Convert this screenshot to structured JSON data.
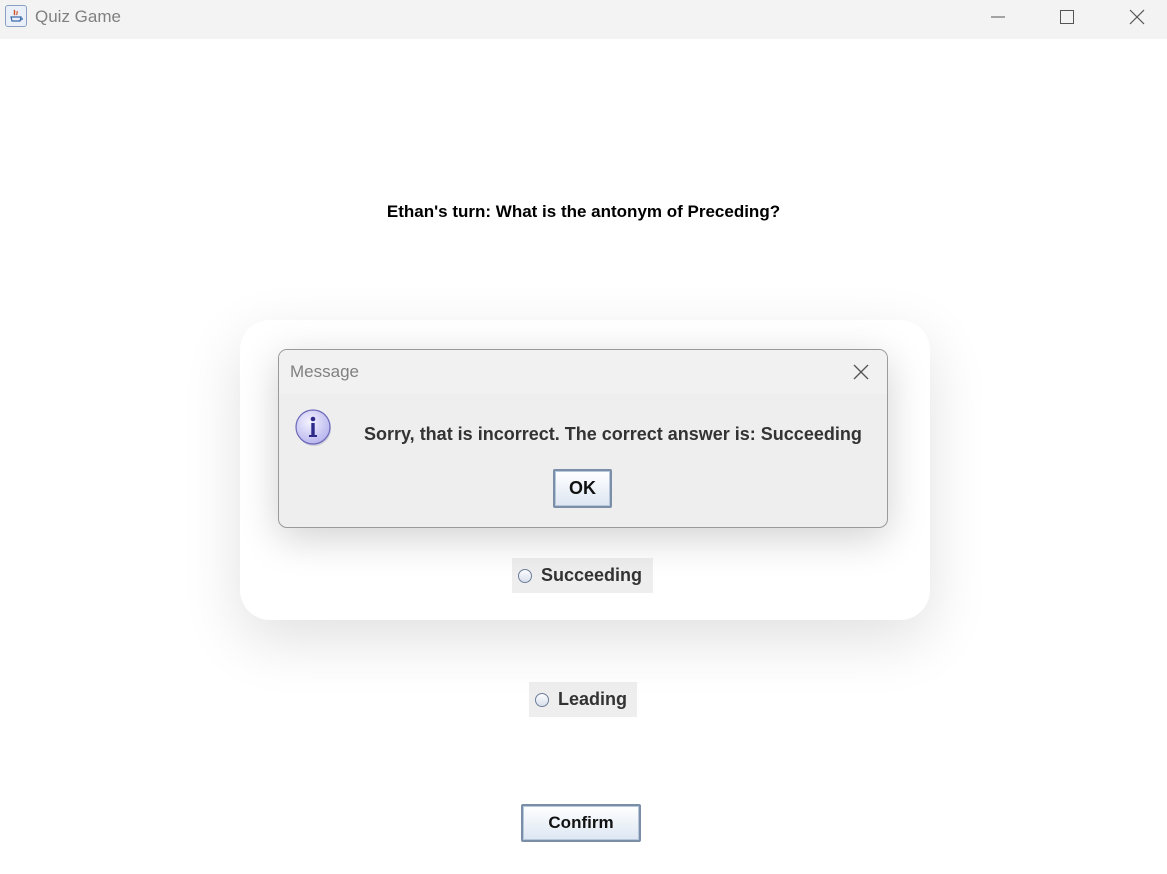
{
  "window": {
    "title": "Quiz Game",
    "icon": "java-icon"
  },
  "quiz": {
    "question": "Ethan's turn: What is the antonym of Preceding?",
    "options": [
      {
        "label": "Succeeding",
        "selected": false
      },
      {
        "label": "Leading",
        "selected": false
      }
    ],
    "confirm_label": "Confirm"
  },
  "dialog": {
    "title": "Message",
    "icon": "info-icon",
    "message": "Sorry, that is incorrect. The correct answer is: Succeeding",
    "ok_label": "OK"
  },
  "colors": {
    "button_border": "#7a8ea8",
    "info_icon_fill": "#c9c8f3"
  }
}
